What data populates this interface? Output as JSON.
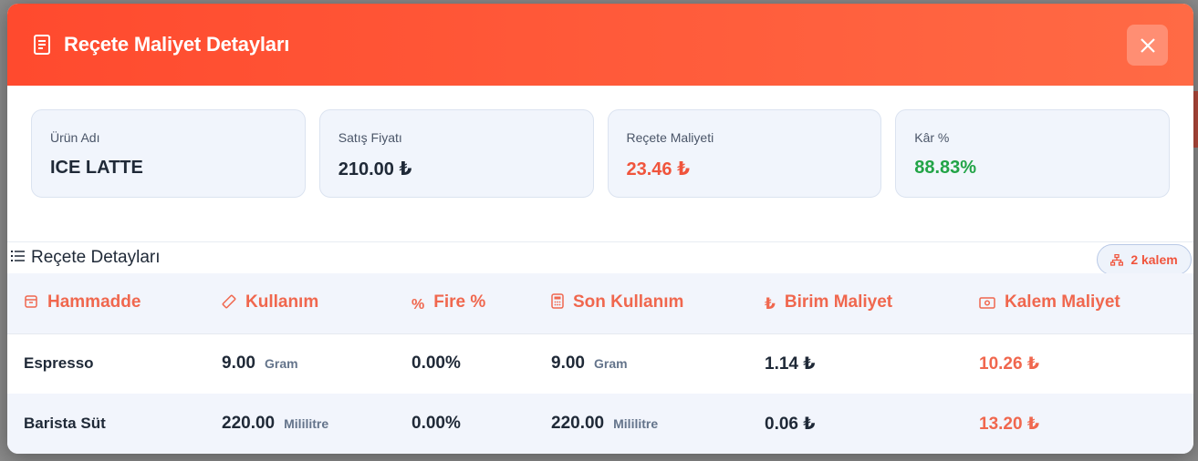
{
  "modal": {
    "title": "Reçete Maliyet Detayları",
    "close_icon": "close-icon"
  },
  "summary": [
    {
      "label": "Ürün Adı",
      "value": "ICE LATTE",
      "color": "#1f2937"
    },
    {
      "label": "Satış Fiyatı",
      "value": "210.00 ₺",
      "color": "#1f2937"
    },
    {
      "label": "Reçete Maliyeti",
      "value": "23.46 ₺",
      "color": "#f0543c"
    },
    {
      "label": "Kâr %",
      "value": "88.83%",
      "color": "#22a447"
    }
  ],
  "details": {
    "title": "Reçete Detayları",
    "badge": "2 kalem",
    "columns": [
      "Hammadde",
      "Kullanım",
      "Fire %",
      "Son Kullanım",
      "Birim Maliyet",
      "Kalem Maliyet"
    ],
    "rows": [
      {
        "name": "Espresso",
        "usage": "9.00",
        "usage_unit": "Gram",
        "fire": "0.00%",
        "final": "9.00",
        "final_unit": "Gram",
        "unit_cost": "1.14 ₺",
        "line_cost": "10.26 ₺"
      },
      {
        "name": "Barista Süt",
        "usage": "220.00",
        "usage_unit": "Mililitre",
        "fire": "0.00%",
        "final": "220.00",
        "final_unit": "Mililitre",
        "unit_cost": "0.06 ₺",
        "line_cost": "13.20 ₺"
      }
    ]
  },
  "colors": {
    "accent": "#ff4a2e",
    "cost": "#f0674e",
    "profit": "#22a447"
  }
}
